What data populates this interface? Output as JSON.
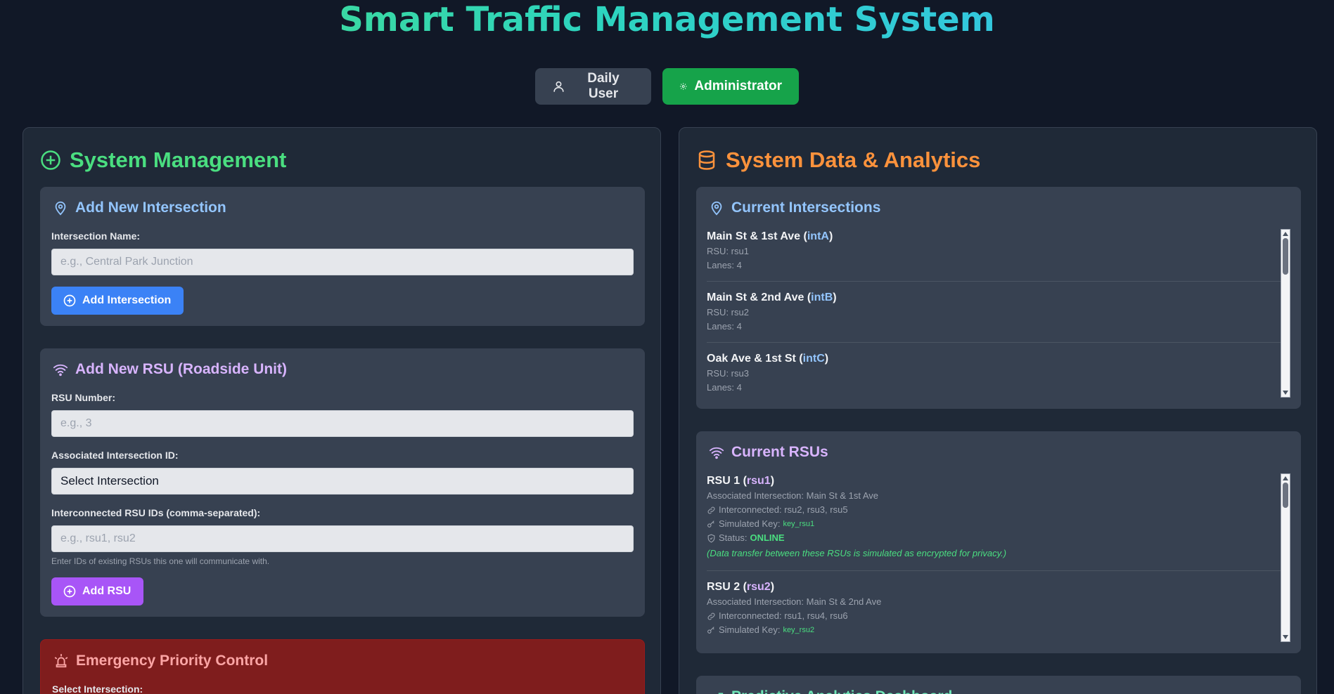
{
  "app": {
    "title": "Smart Traffic Management System"
  },
  "roles": {
    "user_label": "Daily User",
    "admin_label": "Administrator"
  },
  "colors": {
    "management_heading": "#4ade80",
    "analytics_heading": "#fb923c",
    "intersection_accent": "#93c5fd",
    "rsu_accent": "#d8b4fe",
    "emergency_heading": "#fca5a5",
    "emergency_bg": "#7f1d1d"
  },
  "management": {
    "title": "System Management",
    "add_intersection": {
      "title": "Add New Intersection",
      "name_label": "Intersection Name:",
      "name_placeholder": "e.g., Central Park Junction",
      "button": "Add Intersection"
    },
    "add_rsu": {
      "title": "Add New RSU (Roadside Unit)",
      "number_label": "RSU Number:",
      "number_placeholder": "e.g., 3",
      "intersection_label": "Associated Intersection ID:",
      "intersection_value": "Select Intersection",
      "interconnected_label": "Interconnected RSU IDs (comma-separated):",
      "interconnected_placeholder": "e.g., rsu1, rsu2",
      "hint": "Enter IDs of existing RSUs this one will communicate with.",
      "button": "Add RSU"
    },
    "emergency": {
      "title": "Emergency Priority Control",
      "select_label": "Select Intersection:"
    }
  },
  "analytics": {
    "title": "System Data & Analytics",
    "intersections": {
      "title": "Current Intersections",
      "items": [
        {
          "name": "Main St & 1st Ave",
          "id": "intA",
          "rsu": "RSU: rsu1",
          "lanes": "Lanes: 4"
        },
        {
          "name": "Main St & 2nd Ave",
          "id": "intB",
          "rsu": "RSU: rsu2",
          "lanes": "Lanes: 4"
        },
        {
          "name": "Oak Ave & 1st St",
          "id": "intC",
          "rsu": "RSU: rsu3",
          "lanes": "Lanes: 4"
        }
      ]
    },
    "rsus": {
      "title": "Current RSUs",
      "items": [
        {
          "name": "RSU 1",
          "id": "rsu1",
          "intersection": "Associated Intersection: Main St & 1st Ave",
          "interconnected": "Interconnected: rsu2, rsu3, rsu5",
          "key_label": "Simulated Key:",
          "key": "key_rsu1",
          "status_label": "Status:",
          "status": "ONLINE",
          "note": "(Data transfer between these RSUs is simulated as encrypted for privacy.)"
        },
        {
          "name": "RSU 2",
          "id": "rsu2",
          "intersection": "Associated Intersection: Main St & 2nd Ave",
          "interconnected": "Interconnected: rsu1, rsu4, rsu6",
          "key_label": "Simulated Key:",
          "key": "key_rsu2"
        }
      ]
    },
    "predictive": {
      "title": "Predictive Analytics Dashboard"
    }
  }
}
